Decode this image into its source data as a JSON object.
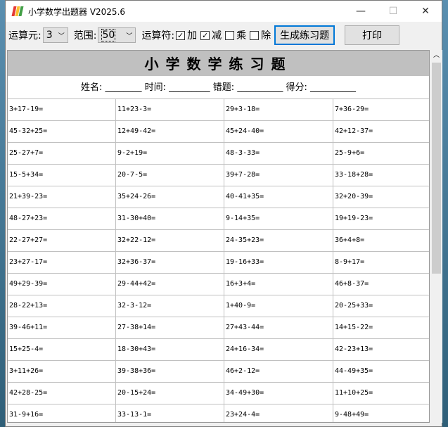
{
  "window": {
    "title": "小学数学出题器 V2025.6",
    "minimize": "—",
    "maximize": "☐",
    "close": "✕"
  },
  "toolbar": {
    "operand_label": "运算元:",
    "operand_value": "3",
    "range_label": "范围:",
    "range_value": "50",
    "ops_label": "运算符:",
    "ops": [
      {
        "label": "加",
        "checked": true
      },
      {
        "label": "减",
        "checked": true
      },
      {
        "label": "乘",
        "checked": false
      },
      {
        "label": "除",
        "checked": false
      }
    ],
    "generate": "生成练习题",
    "print": "打印"
  },
  "sheet": {
    "title": "小学数学练习题",
    "info": "姓名: ________ 时间: _________ 错题: __________ 得分: __________",
    "problems": [
      [
        "3+17-19=",
        "11+23-3=",
        "29+3-18=",
        "7+36-29="
      ],
      [
        "45-32+25=",
        "12+49-42=",
        "45+24-40=",
        "42+12-37="
      ],
      [
        "25-27+7=",
        "9-2+19=",
        "48-3-33=",
        "25-9+6="
      ],
      [
        "15-5+34=",
        "20-7-5=",
        "39+7-28=",
        "33-18+28="
      ],
      [
        "21+39-23=",
        "35+24-26=",
        "40-41+35=",
        "32+20-39="
      ],
      [
        "48-27+23=",
        "31-30+40=",
        "9-14+35=",
        "19+19-23="
      ],
      [
        "22-27+27=",
        "32+22-12=",
        "24-35+23=",
        "36+4+8="
      ],
      [
        "23+27-17=",
        "32+36-37=",
        "19-16+33=",
        "8-9+17="
      ],
      [
        "49+29-39=",
        "29-44+42=",
        "16+3+4=",
        "46+8-37="
      ],
      [
        "28-22+13=",
        "32-3-12=",
        "1+40-9=",
        "20-25+33="
      ],
      [
        "39-46+11=",
        "27-38+14=",
        "27+43-44=",
        "14+15-22="
      ],
      [
        "15+25-4=",
        "18-30+43=",
        "24+16-34=",
        "42-23+13="
      ],
      [
        "3+11+26=",
        "39-38+36=",
        "46+2-12=",
        "44-49+35="
      ],
      [
        "42+28-25=",
        "20-15+24=",
        "34-49+30=",
        "11+10+25="
      ],
      [
        "31-9+16=",
        "33-13-1=",
        "23+24-4=",
        "9-48+49="
      ]
    ]
  },
  "colors": {
    "accent": "#0078d7",
    "header_bg": "#c0c0c0"
  }
}
